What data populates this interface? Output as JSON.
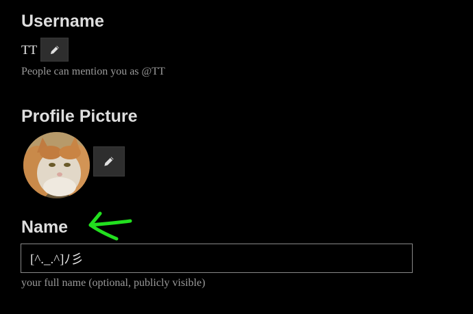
{
  "username": {
    "heading": "Username",
    "value": "TT",
    "help": "People can mention you as @TT",
    "edit_icon": "pencil-icon"
  },
  "profile_picture": {
    "heading": "Profile Picture",
    "edit_icon": "pencil-icon",
    "avatar": "cat-photo"
  },
  "name": {
    "heading": "Name",
    "value": "[^._.^]ﾉ彡",
    "help": "your full name (optional, publicly visible)"
  },
  "annotation": {
    "arrow_color": "#22e01f"
  }
}
